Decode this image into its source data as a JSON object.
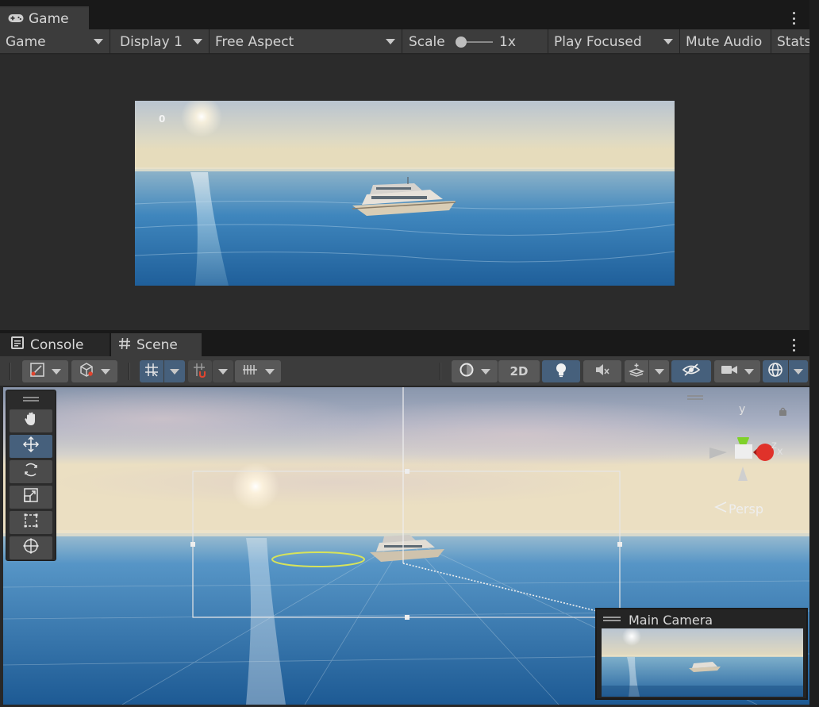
{
  "game": {
    "tab_label": "Game",
    "toolbar": {
      "mode": "Game",
      "display": "Display 1",
      "aspect": "Free Aspect",
      "scale_label": "Scale",
      "scale_value": "1x",
      "play_mode": "Play Focused",
      "mute": "Mute Audio",
      "stats": "Stats"
    },
    "view": {
      "counter": "0"
    }
  },
  "scene_panel": {
    "tabs": [
      {
        "label": "Console",
        "icon": "console-icon"
      },
      {
        "label": "Scene",
        "icon": "hash-icon"
      }
    ],
    "toolbar": {
      "toggle_2d": "2D",
      "icons": [
        "draw-mode-icon",
        "shading-cube-icon",
        "grid-icon",
        "snap-magnet-icon",
        "ruler-grid-icon",
        "render-sphere-icon",
        "light-bulb-icon",
        "mute-audio-icon",
        "effects-layers-icon",
        "hidden-eye-icon",
        "camera-icon",
        "gizmo-globe-icon"
      ]
    },
    "tools": [
      "hand-icon",
      "move-icon",
      "rotate-icon",
      "scale-icon",
      "rect-icon",
      "transform-icon"
    ],
    "gizmo": {
      "y_label": "y",
      "z_label": "z",
      "x_label": "x",
      "persp_label": "Persp"
    },
    "camera_overlay": {
      "title": "Main Camera"
    }
  },
  "colors": {
    "panel_bg": "#282828",
    "toolbar_bg": "#3c3c3c",
    "active_blue": "#46607c",
    "gizmo_y": "#7fd12a",
    "gizmo_x": "#e0322a"
  }
}
